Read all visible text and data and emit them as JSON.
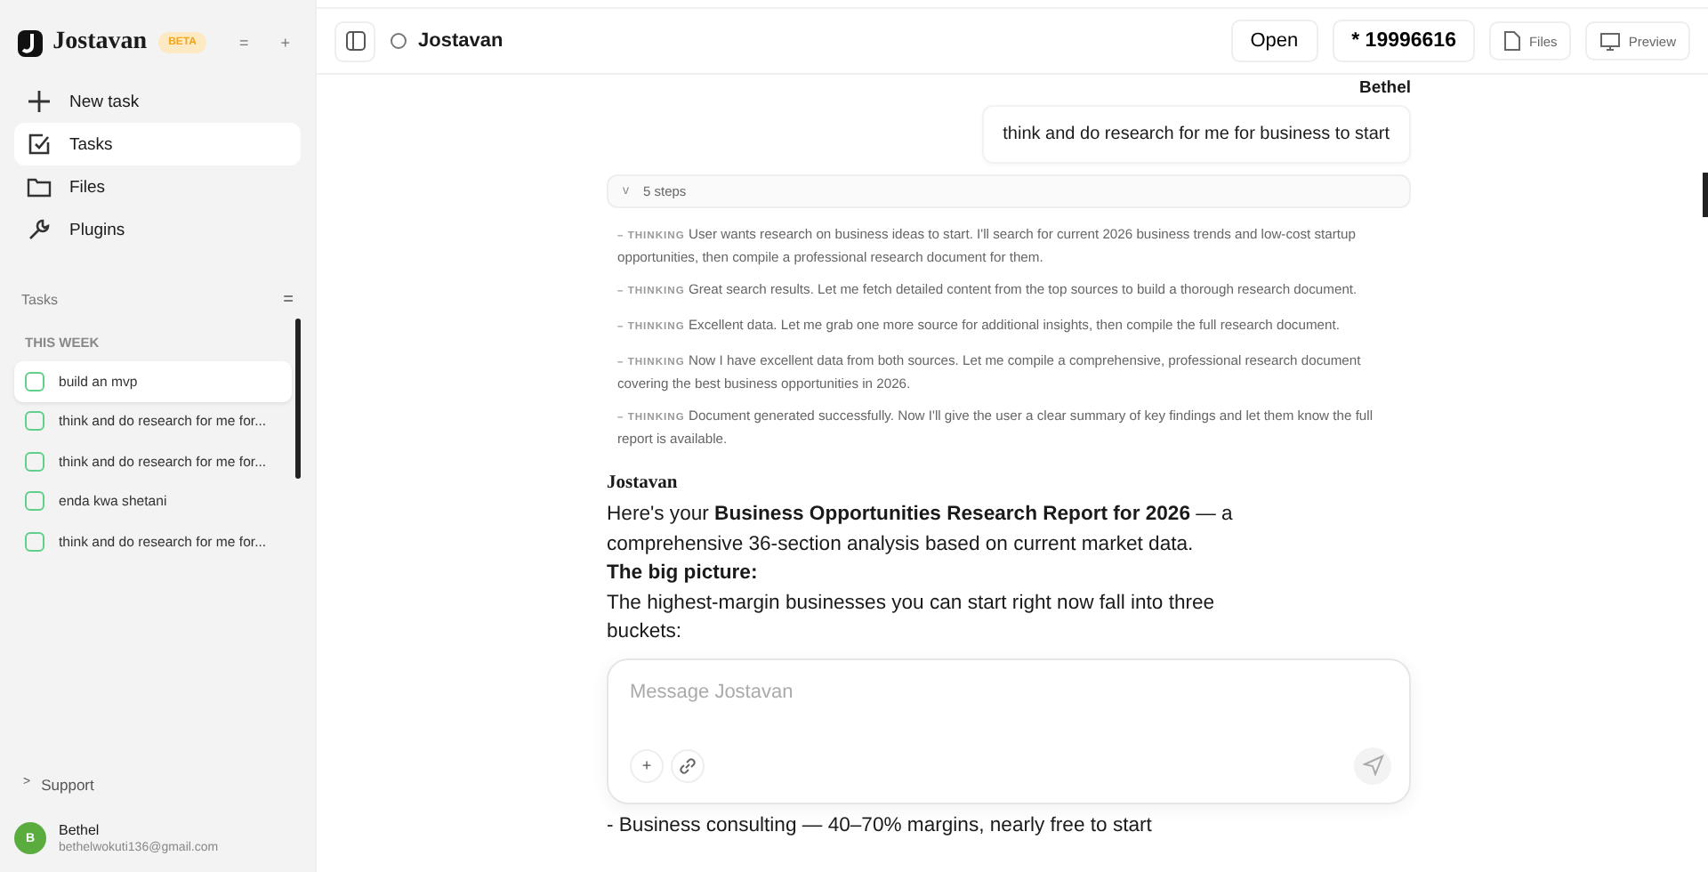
{
  "sidebar": {
    "brand": "Jostavan",
    "badge": "BETA",
    "header_buttons": [
      "=",
      "+"
    ],
    "nav": [
      {
        "label": "New task",
        "selected": false
      },
      {
        "label": "Tasks",
        "selected": true
      },
      {
        "label": "Files",
        "selected": false
      },
      {
        "label": "Plugins",
        "selected": false
      }
    ],
    "tasks_heading": "Tasks",
    "tasks_menu": "=",
    "group": "THIS WEEK",
    "tasks": [
      {
        "label": "build an mvp",
        "selected": true
      },
      {
        "label": "think and do research for me for...",
        "selected": false
      },
      {
        "label": "think and do research for me for...",
        "selected": false
      },
      {
        "label": "enda kwa shetani",
        "selected": false
      },
      {
        "label": "think and do research for me for...",
        "selected": false
      }
    ],
    "support": {
      "caret": ">",
      "label": "Support"
    },
    "user": {
      "initial": "B",
      "name": "Bethel",
      "email": "bethelwokuti136@gmail.com"
    }
  },
  "header": {
    "title": "Jostavan",
    "open": "Open",
    "count": "* 19996616",
    "files": "Files",
    "preview": "Preview"
  },
  "chat": {
    "user_name": "Bethel",
    "user_message": "think and do research for me for business to start",
    "steps": {
      "caret": "v",
      "label": "5 steps",
      "items": [
        {
          "tag": "– THINKING",
          "text": "User wants research on business ideas to start. I'll search for current 2026 business trends and low-cost startup opportunities, then compile a professional research document for them."
        },
        {
          "tag": "– THINKING",
          "text": "Great search results. Let me fetch detailed content from the top sources to build a thorough research document."
        },
        {
          "tag": "– THINKING",
          "text": "Excellent data. Let me grab one more source for additional insights, then compile the full research document."
        },
        {
          "tag": "– THINKING",
          "text": "Now I have excellent data from both sources. Let me compile a comprehensive, professional research document covering the best business opportunities in 2026."
        },
        {
          "tag": "– THINKING",
          "text": "Document generated successfully. Now I'll give the user a clear summary of key findings and let them know the full report is available."
        }
      ]
    },
    "assistant_name": "Jostavan",
    "paragraphs": [
      {
        "kind": "text",
        "text": "Here's your **Business Opportunities Research Report for 2026** — a comprehensive 36-section analysis based on current market data."
      },
      {
        "kind": "heading",
        "text": "The big picture:"
      },
      {
        "kind": "text",
        "text": "The highest-margin businesses you can start right now fall into three buckets:"
      }
    ],
    "below_composer": "- Business consulting — 40–70% margins, nearly free to start"
  },
  "composer": {
    "placeholder": "Message Jostavan",
    "add": "+"
  }
}
